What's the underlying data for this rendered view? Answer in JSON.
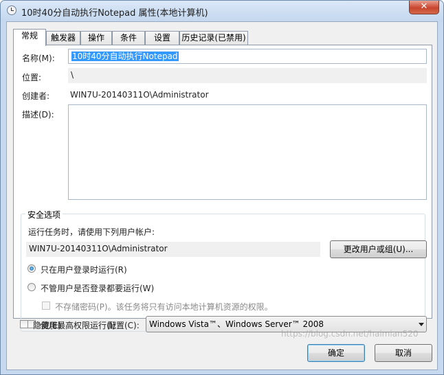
{
  "window": {
    "title": "10时40分自动执行Notepad 属性(本地计算机)",
    "close_symbol": "✕"
  },
  "tabs": [
    {
      "label": "常规",
      "active": true
    },
    {
      "label": "触发器"
    },
    {
      "label": "操作"
    },
    {
      "label": "条件"
    },
    {
      "label": "设置"
    },
    {
      "label": "历史记录(已禁用)"
    }
  ],
  "general": {
    "name_label": "名称(M):",
    "name_value": "10时40分自动执行Notepad",
    "location_label": "位置:",
    "location_value": "\\",
    "author_label": "创建者:",
    "author_value": "WIN7U-20140311O\\Administrator",
    "description_label": "描述(D):",
    "description_value": ""
  },
  "security": {
    "title": "安全选项",
    "run_as_prompt": "运行任务时，请使用下列用户帐户:",
    "account_value": "WIN7U-20140311O\\Administrator",
    "change_user_button": "更改用户或组(U)...",
    "radio_logged_on": "只在用户登录时运行(R)",
    "radio_logged_on_selected": true,
    "radio_whether_logged": "不管用户是否登录都要运行(W)",
    "checkbox_no_password": "不存储密码(P)。该任务将只有访问本地计算机资源的权限。",
    "checkbox_highest_privileges": "使用最高权限运行(I)"
  },
  "bottom": {
    "hidden_label": "隐藏(E)",
    "configure_label": "配置(C):",
    "configure_value": "Windows Vista™、Windows Server™ 2008",
    "ok_button": "确定",
    "cancel_button": "取消"
  },
  "watermark": "https://blog.csdn.net/haimian520"
}
